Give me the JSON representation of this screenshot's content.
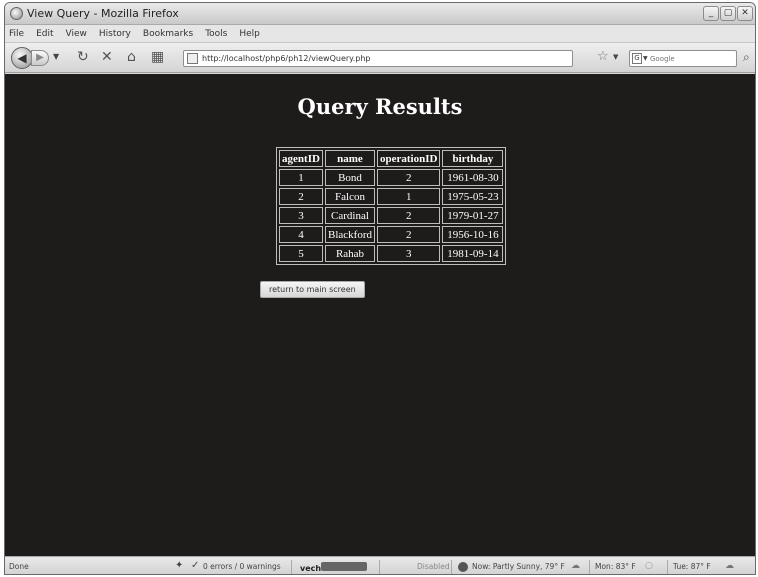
{
  "window": {
    "title": "View Query - Mozilla Firefox",
    "controls": {
      "minimize": "_",
      "maximize": "▢",
      "close": "✕"
    }
  },
  "menu": [
    "File",
    "Edit",
    "View",
    "History",
    "Bookmarks",
    "Tools",
    "Help"
  ],
  "nav": {
    "url": "http://localhost/php6/ph12/viewQuery.php",
    "search_placeholder": "Google",
    "search_engine_letter": "G"
  },
  "page": {
    "heading": "Query Results",
    "table": {
      "headers": [
        "agentID",
        "name",
        "operationID",
        "birthday"
      ],
      "rows": [
        [
          "1",
          "Bond",
          "2",
          "1961-08-30"
        ],
        [
          "2",
          "Falcon",
          "1",
          "1975-05-23"
        ],
        [
          "3",
          "Cardinal",
          "2",
          "1979-01-27"
        ],
        [
          "4",
          "Blackford",
          "2",
          "1956-10-16"
        ],
        [
          "5",
          "Rahab",
          "3",
          "1981-09-14"
        ]
      ]
    },
    "return_button": "return to main screen"
  },
  "status": {
    "text": "Done",
    "errors": "0 errors / 0 warnings",
    "vech": "vech",
    "disabled": "Disabled",
    "weather_now": "Now: Partly Sunny, 79° F",
    "forecast_mon": "Mon: 83° F",
    "forecast_tue": "Tue: 87° F"
  },
  "colors": {
    "page_background": "#1e1b1b",
    "page_text": "#ffffff"
  }
}
